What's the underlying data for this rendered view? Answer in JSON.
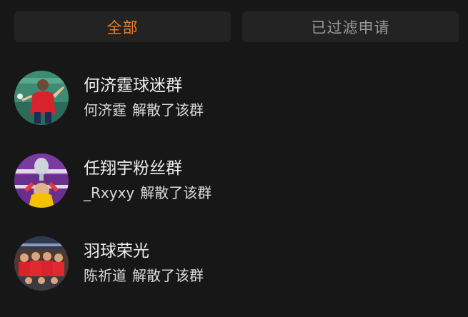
{
  "tabs": [
    {
      "label": "全部",
      "active": true
    },
    {
      "label": "已过滤申请",
      "active": false
    }
  ],
  "accent_color": "#f07d2a",
  "groups": [
    {
      "name": "何济霆球迷群",
      "actor": "何济霆",
      "action": "解散了该群",
      "avatar_icon": "player-photo-avatar"
    },
    {
      "name": "任翔宇粉丝群",
      "actor": "_Rxyxy",
      "action": "解散了该群",
      "avatar_icon": "trophy-photo-avatar"
    },
    {
      "name": "羽球荣光",
      "actor": "陈祈道",
      "action": "解散了该群",
      "avatar_icon": "team-photo-avatar"
    }
  ]
}
